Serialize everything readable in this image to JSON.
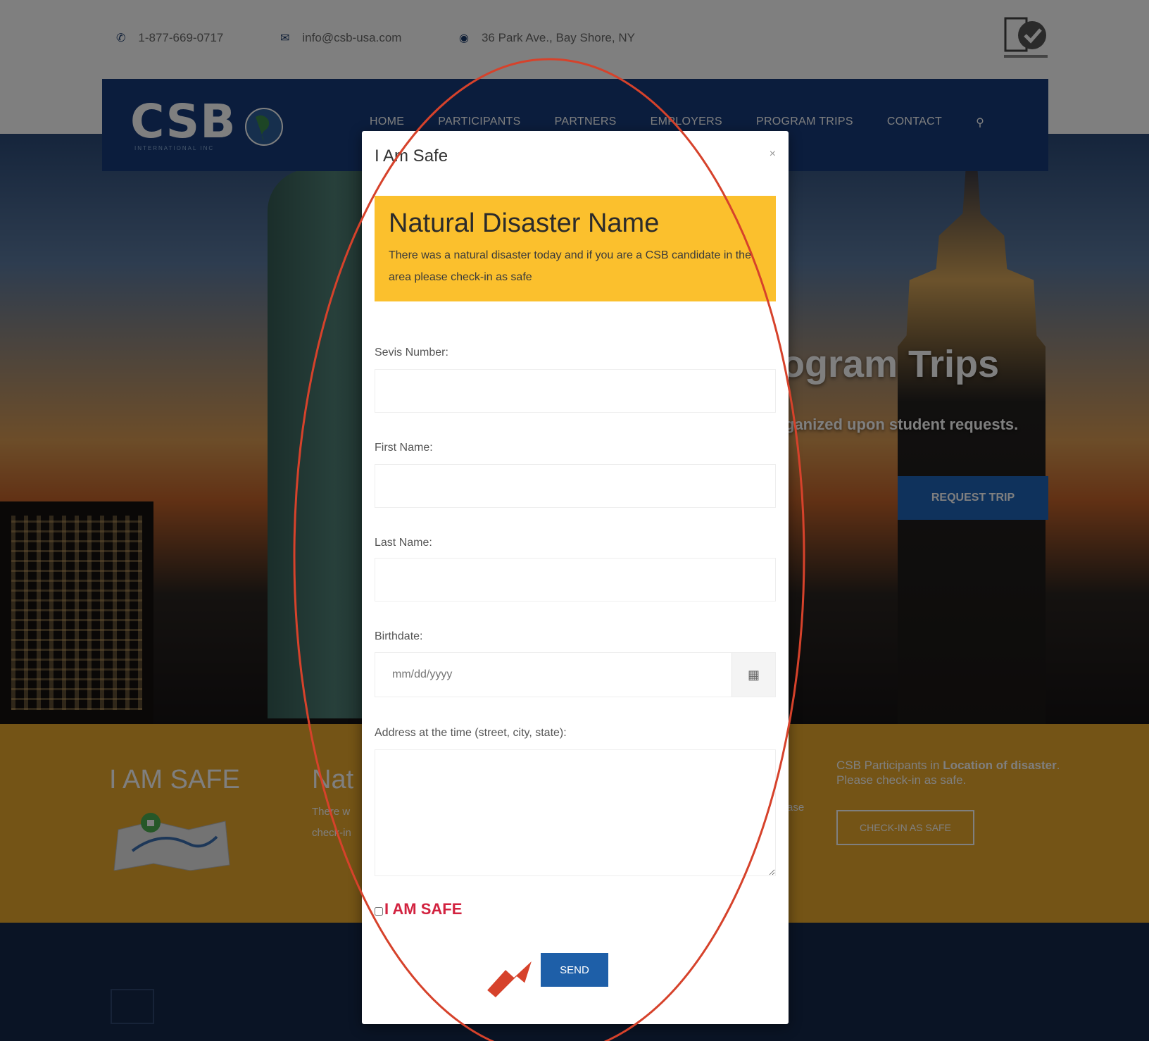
{
  "topbar": {
    "phone": "1-877-669-0717",
    "email": "info@csb-usa.com",
    "address": "36 Park Ave., Bay Shore, NY"
  },
  "brand": {
    "logo": "CSB",
    "tagline": "INTERNATIONAL INC"
  },
  "nav": {
    "items": [
      "HOME",
      "PARTICIPANTS",
      "PARTNERS",
      "EMPLOYERS",
      "PROGRAM TRIPS",
      "CONTACT"
    ],
    "search_icon": "search-icon"
  },
  "hero": {
    "title": "ogram Trips",
    "subtitle": "ganized upon student requests.",
    "button": "REQUEST TRIP"
  },
  "safe_band": {
    "title": "I AM SAFE",
    "heading_fragment": "Nat",
    "text_fragment_1": "There w",
    "text_fragment_2": "check-in",
    "text_fragment_3": "ase",
    "right_text_prefix": "CSB Participants in ",
    "right_text_bold": "Location of disaster",
    "right_text_suffix": ". Please check-in as safe.",
    "button": "CHECK-IN AS SAFE"
  },
  "modal": {
    "title": "I Am Safe",
    "close": "×",
    "alert_title": "Natural Disaster Name",
    "alert_text": "There was a natural disaster today and if you are a CSB candidate in the area please check-in as safe",
    "fields": {
      "sevis_label": "Sevis Number:",
      "first_name_label": "First Name:",
      "last_name_label": "Last Name:",
      "birthdate_label": "Birthdate:",
      "birthdate_placeholder": "mm/dd/yyyy",
      "address_label": "Address at the time (street, city, state):"
    },
    "checkbox_label": "I AM SAFE",
    "send": "SEND"
  },
  "colors": {
    "navy": "#163a7a",
    "alert_yellow": "#fbc02d",
    "band_gold": "#e9a92c",
    "safe_red": "#d2223f",
    "send_blue": "#1e5fa8",
    "annotation_red": "#d6422b"
  }
}
